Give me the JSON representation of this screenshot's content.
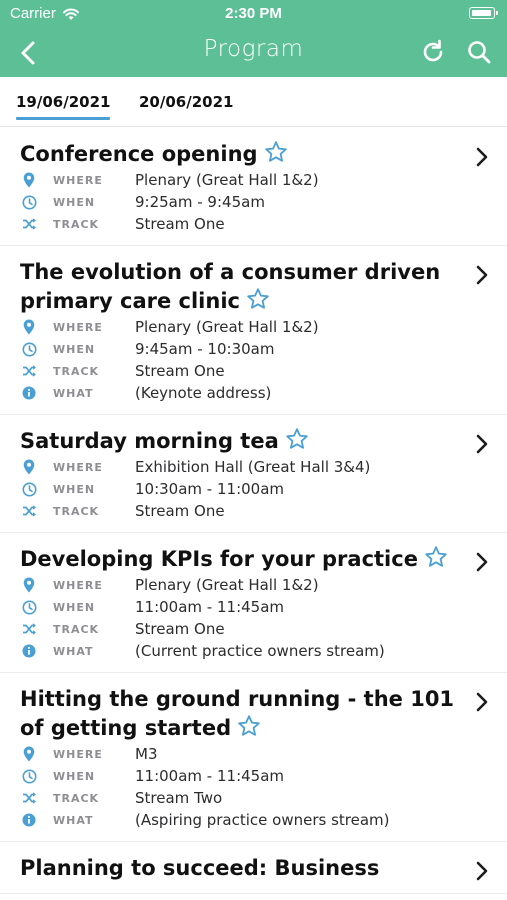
{
  "status_bar": {
    "carrier": "Carrier",
    "time": "2:30 PM"
  },
  "nav": {
    "title": "Program",
    "back_icon": "chevron-left-icon",
    "refresh_icon": "refresh-icon",
    "search_icon": "search-icon"
  },
  "tabs": [
    {
      "label": "19/06/2021",
      "selected": true
    },
    {
      "label": "20/06/2021",
      "selected": false
    }
  ],
  "labels": {
    "where": "WHERE",
    "when": "WHEN",
    "track": "TRACK",
    "what": "WHAT"
  },
  "colors": {
    "header": "#5cbf96",
    "accent": "#4a9fd4"
  },
  "sessions": [
    {
      "title": "Conference opening",
      "where": "Plenary (Great Hall 1&2)",
      "when": "9:25am - 9:45am",
      "track": "Stream One"
    },
    {
      "title": "The evolution of a consumer driven primary care clinic",
      "where": "Plenary (Great Hall 1&2)",
      "when": "9:45am - 10:30am",
      "track": "Stream One",
      "what": "(Keynote address)"
    },
    {
      "title": "Saturday morning tea",
      "where": "Exhibition Hall (Great Hall 3&4)",
      "when": "10:30am - 11:00am",
      "track": "Stream One"
    },
    {
      "title": "Developing KPIs for your practice",
      "where": "Plenary (Great Hall 1&2)",
      "when": "11:00am - 11:45am",
      "track": "Stream One",
      "what": "(Current practice owners stream)"
    },
    {
      "title": "Hitting the ground running - the 101 of getting started",
      "where": "M3",
      "when": "11:00am - 11:45am",
      "track": "Stream Two",
      "what": "(Aspiring practice owners stream)"
    },
    {
      "title": "Planning to succeed: Business"
    }
  ]
}
